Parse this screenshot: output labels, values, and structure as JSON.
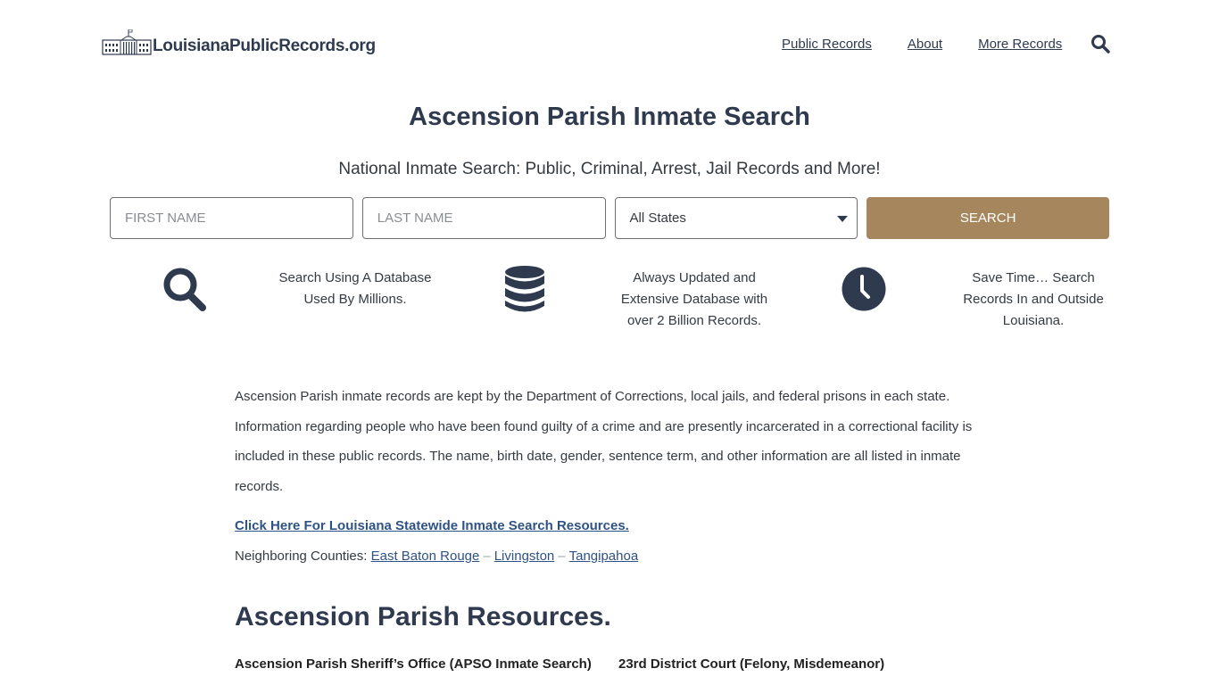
{
  "header": {
    "logo_text": "LouisianaPublicRecords.org",
    "nav": [
      {
        "label": "Public Records"
      },
      {
        "label": "About"
      },
      {
        "label": "More Records"
      }
    ],
    "search_icon": "search-icon"
  },
  "hero": {
    "title": "Ascension Parish Inmate Search",
    "subtitle": "National Inmate Search: Public, Criminal, Arrest, Jail Records and More!"
  },
  "search_form": {
    "first_name_placeholder": "FIRST NAME",
    "first_name_value": "",
    "last_name_placeholder": "LAST NAME",
    "last_name_value": "",
    "state_selected": "All States",
    "search_label": "SEARCH"
  },
  "features": [
    {
      "icon": "search-icon",
      "text": "Search Using A Database Used By Millions."
    },
    {
      "icon": "database-icon",
      "text": "Always Updated and Extensive Database with over 2 Billion Records."
    },
    {
      "icon": "clock-icon",
      "text": "Save Time… Search Records In and Outside Louisiana."
    }
  ],
  "content": {
    "paragraph": "Ascension Parish inmate records are kept by the Department of Corrections, local jails, and federal prisons in each state. Information regarding people who have been found guilty of a crime and are presently incarcerated in a correctional facility is included in these public records. The name, birth date, gender, sentence term, and other information are all listed in inmate records.",
    "statewide_link": "Click Here For Louisiana Statewide Inmate Search Resources.",
    "neighbors_label": "Neighboring Counties:",
    "neighbors": [
      "East Baton Rouge",
      "Livingston",
      "Tangipahoa"
    ],
    "separator": "–",
    "resources_title": "Ascension Parish Resources.",
    "resources": [
      {
        "label": "Ascension Parish Sheriff’s Office (APSO Inmate Search)"
      },
      {
        "label": "23rd District Court (Felony, Misdemeanor)"
      }
    ]
  },
  "colors": {
    "primary_text": "#2f3a4f",
    "accent_button": "#a6875d",
    "link": "#2f5286"
  }
}
